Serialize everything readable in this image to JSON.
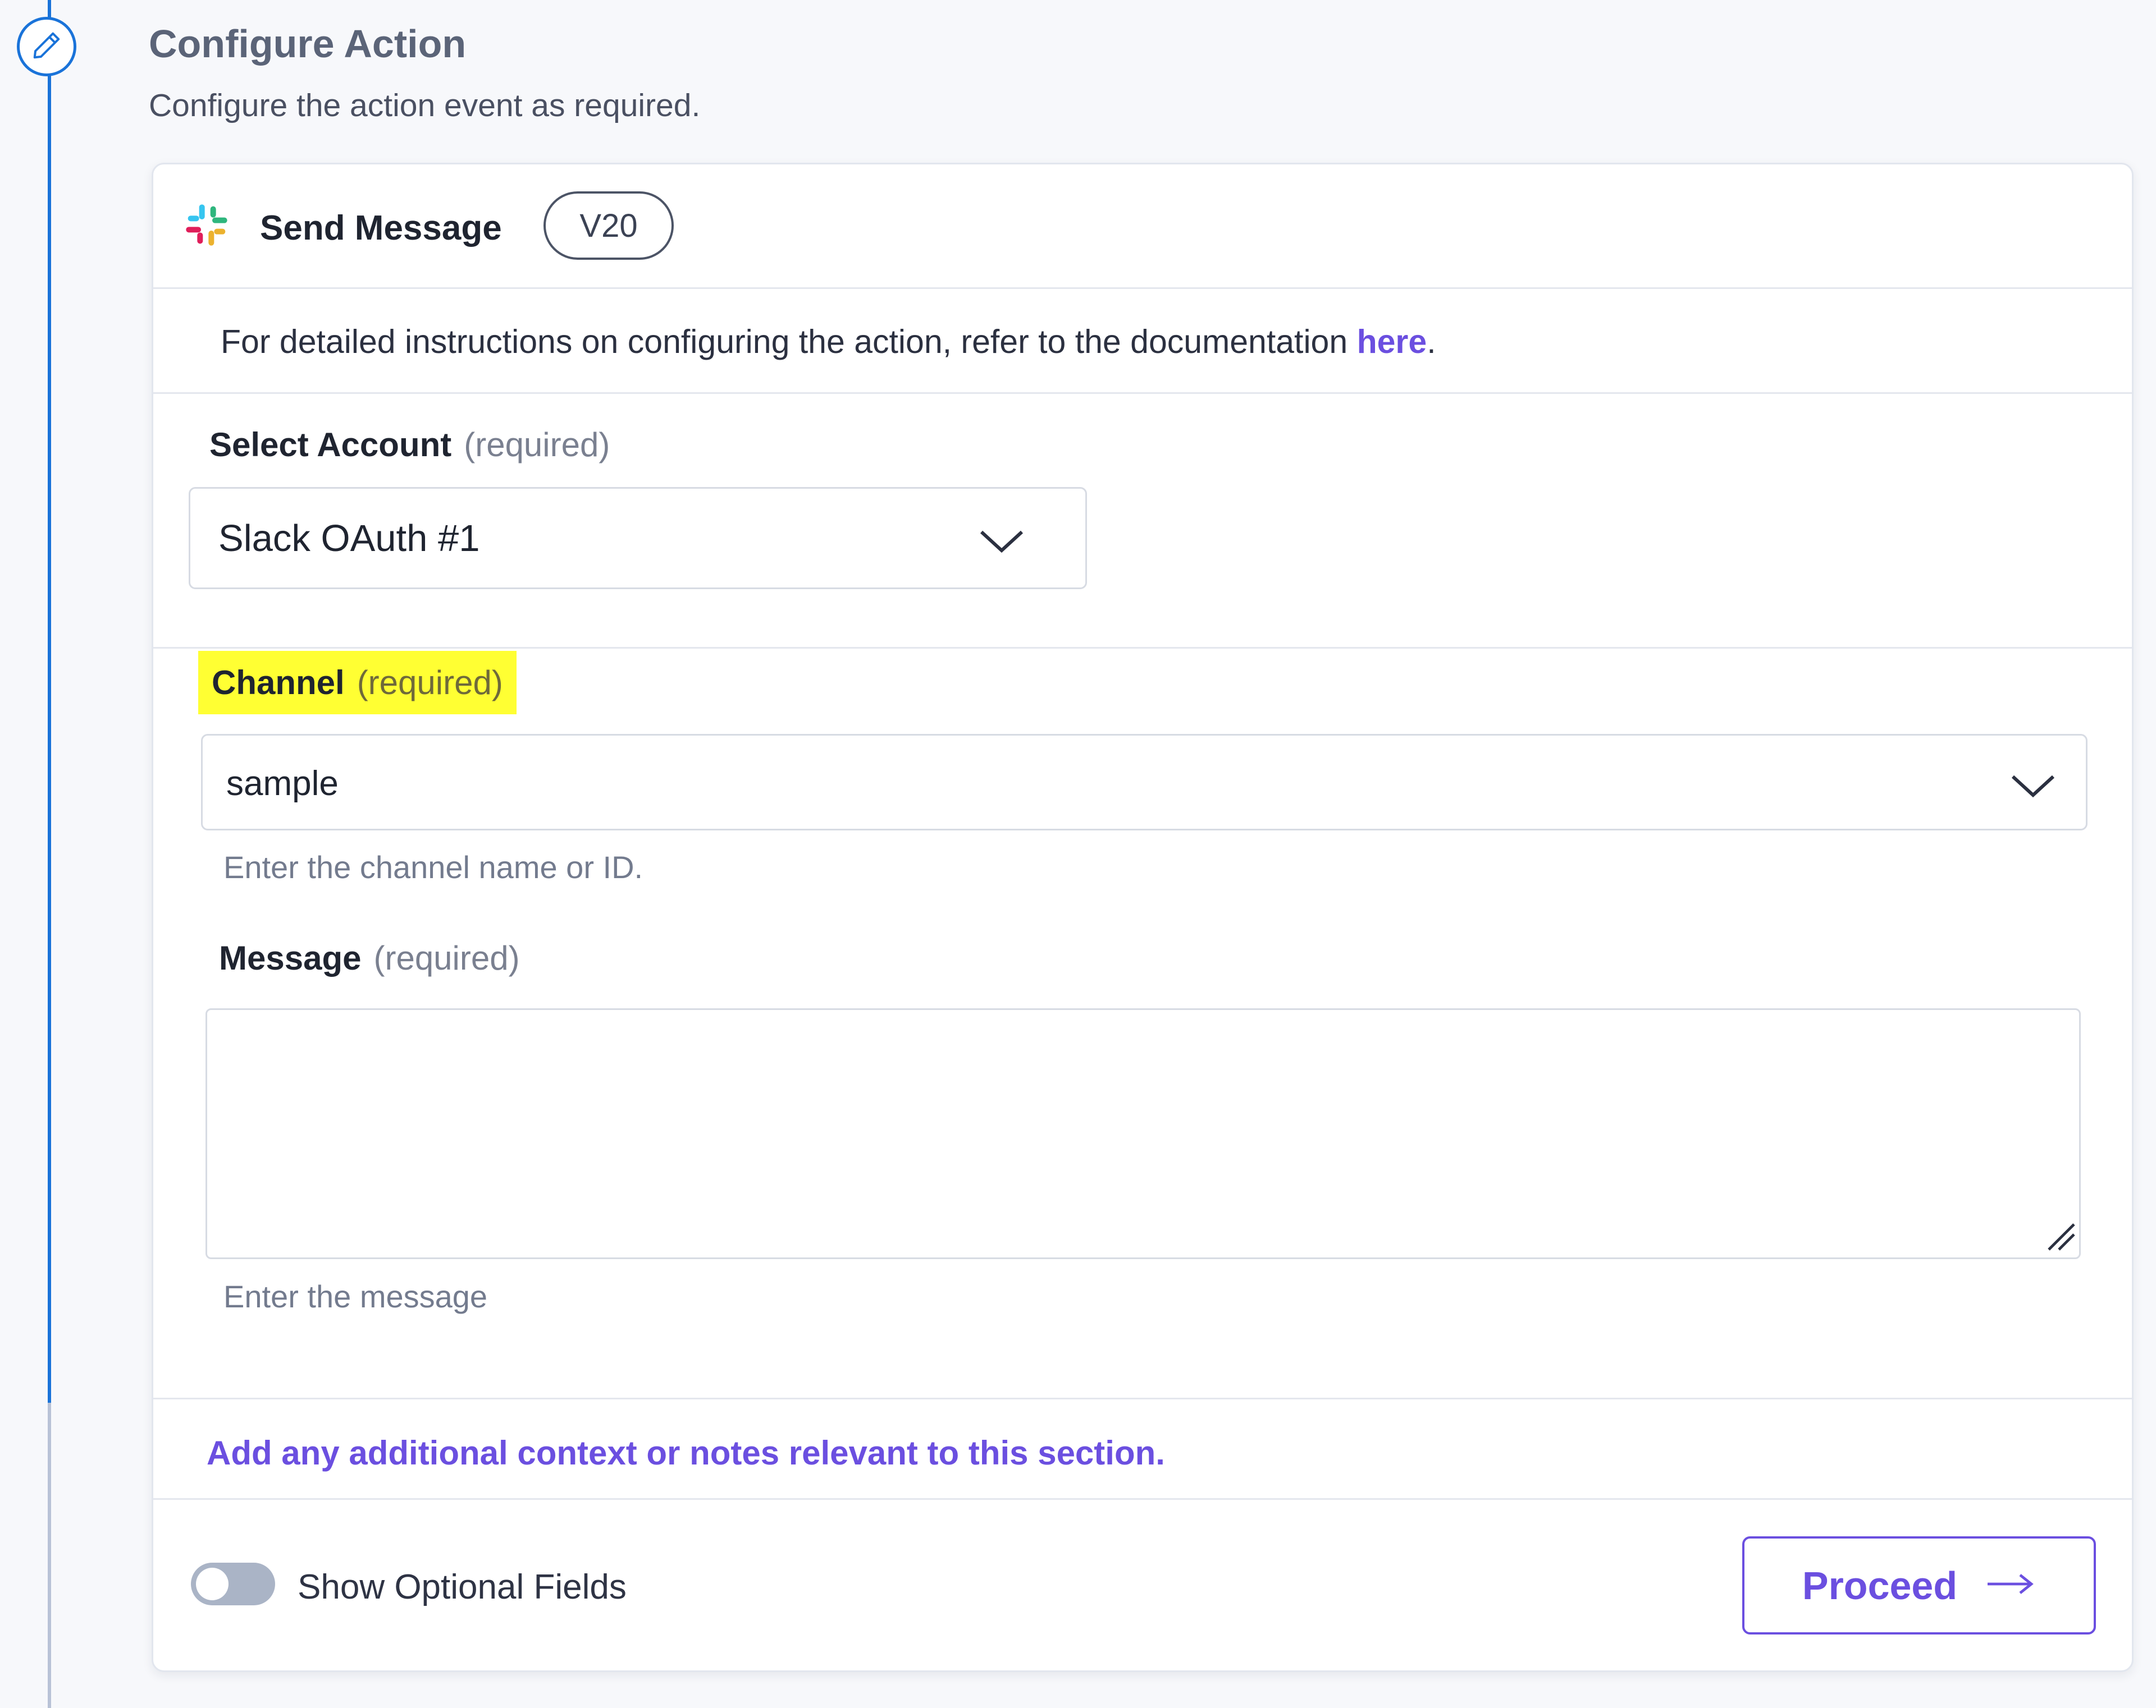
{
  "step": {
    "title": "Configure Action",
    "subtitle": "Configure the action event as required.",
    "icon": "pencil-icon"
  },
  "action": {
    "app_icon": "slack-logo",
    "name": "Send Message",
    "version": "V20"
  },
  "doc": {
    "text": "For detailed instructions on configuring the action, refer to the documentation ",
    "link_label": "here",
    "trailing": "."
  },
  "fields": {
    "account": {
      "label": "Select Account",
      "required": "(required)",
      "value": "Slack OAuth #1"
    },
    "channel": {
      "label": "Channel",
      "required": "(required)",
      "value": "sample",
      "helper": "Enter the channel name or ID."
    },
    "message": {
      "label": "Message",
      "required": "(required)",
      "value": "",
      "helper": "Enter the message"
    }
  },
  "notes_link": "Add any additional context or notes relevant to this section.",
  "footer": {
    "toggle_label": "Show Optional Fields",
    "toggle_on": false,
    "proceed_label": "Proceed"
  },
  "colors": {
    "accent": "#6b4fe0",
    "timeline": "#1a73d9",
    "highlight": "#ffff33"
  }
}
